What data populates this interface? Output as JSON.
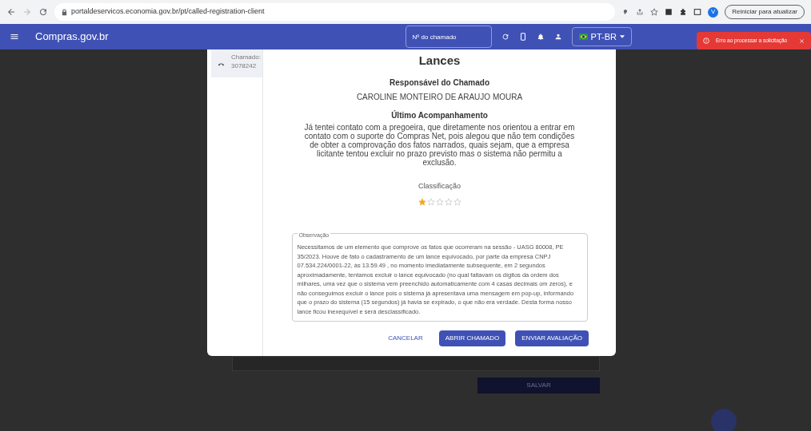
{
  "browser": {
    "url": "portaldeservicos.economia.gov.br/pt/called-registration-client",
    "profile_initial": "V",
    "update_button": "Reiniciar para atualizar"
  },
  "app_bar": {
    "title": "Compras.gov.br",
    "search": {
      "placeholder": "Nº do chamado"
    },
    "language": "PT-BR"
  },
  "toast": {
    "message": "Erro ao processar a solicitação"
  },
  "background": {
    "save_button": "SALVAR"
  },
  "dialog": {
    "sidebar": [
      {
        "label": "Chamado:",
        "number": "3078242",
        "selected": true
      }
    ],
    "title": "Lances",
    "responsible_heading": "Responsável do Chamado",
    "responsible_name": "CAROLINE MONTEIRO DE ARAUJO MOURA",
    "followup_heading": "Último Acompanhamento",
    "followup_text": "Já tentei contato com a pregoeira, que diretamente nos orientou a entrar em contato com o suporte do Compras Net, pois alegou que não tem condições de obter a comprovação dos fatos narrados, quais sejam, que a empresa licitante tentou excluir no prazo previsto mas o sistema não permitu a exclusão.",
    "rating_label": "Classificação",
    "stars": 1,
    "observation": {
      "label": "Observação",
      "value": "Necessitamos de um elemento que comprove os fatos que ocorreram na sessão - UASG 80008, PE 35/2023. Houve de fato o cadastramento de um lance equivocado, por parte da empresa CNPJ 07.534.224/0001-22, às 13.59.49 , no momento imediatamente subsequente, em 2 segundos aproximadamente, tentamos excluir o lance equivocado  (no qual faltavam os dígitos da ordem dos milhares, uma vez que o sistema vem preenchido automaticamente com 4 casas decimais om zeros), e não conseguimos excluir o lance pois o sistema já apresentava uma mensagem em pop-up, informando que o prazo do sistema (15 segundos) já havia se expirado, o que não era verdade. Desta forma nosso lance ficou inexequível e será desclassificado."
    },
    "buttons": [
      {
        "label": "CANCELAR",
        "kind": "text"
      },
      {
        "label": "ABRIR CHAMADO",
        "kind": "primary"
      },
      {
        "label": "ENVIAR AVALIAÇÃO",
        "kind": "primary"
      }
    ]
  }
}
